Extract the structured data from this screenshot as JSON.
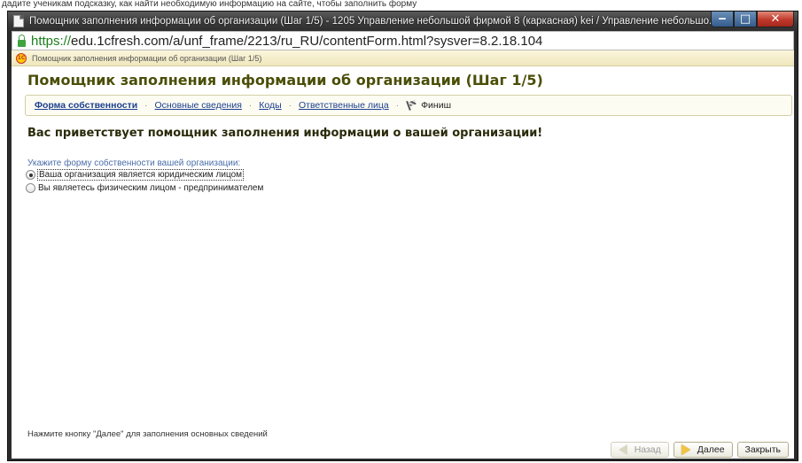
{
  "caption": "дадите ученикам подсказку, как найти необходимую информацию на сайте, чтобы заполнить форму",
  "window": {
    "title": "Помощник заполнения информации об организации (Шаг 1/5) - 1205 Управление небольшой фирмой 8 (каркасная) kei / Управление небольшо...",
    "buttons": {
      "minimize": "‒",
      "maximize": "□",
      "close": "✕"
    }
  },
  "address": {
    "scheme": "https://",
    "rest": "edu.1cfresh.com/a/unf_frame/2213/ru_RU/contentForm.html?sysver=8.2.18.104"
  },
  "form": {
    "header_text": "Помощник заполнения информации об организации (Шаг 1/5)",
    "logo": "1С",
    "title": "Помощник заполнения информации об организации (Шаг 1/5)",
    "steps": [
      "Форма собственности",
      "Основные сведения",
      "Коды",
      "Ответственные лица",
      "Финиш"
    ],
    "step_separator": "·",
    "welcome": "Вас приветствует помощник заполнения информации о вашей организации!",
    "prompt": "Укажите форму собственности вашей организации:",
    "options": [
      {
        "label": "Ваша организация является юридическим лицом",
        "checked": true
      },
      {
        "label": "Вы являетесь физическим лицом - предпринимателем",
        "checked": false
      }
    ],
    "hint": "Нажмите кнопку \"Далее\" для заполнения основных сведений",
    "buttons": {
      "back": "Назад",
      "next": "Далее",
      "close": "Закрыть"
    }
  },
  "colors": {
    "title": "#4b4e07",
    "link": "#1c3f8f",
    "prompt": "#4a6ea9",
    "header_bg": "#efe7bd"
  }
}
